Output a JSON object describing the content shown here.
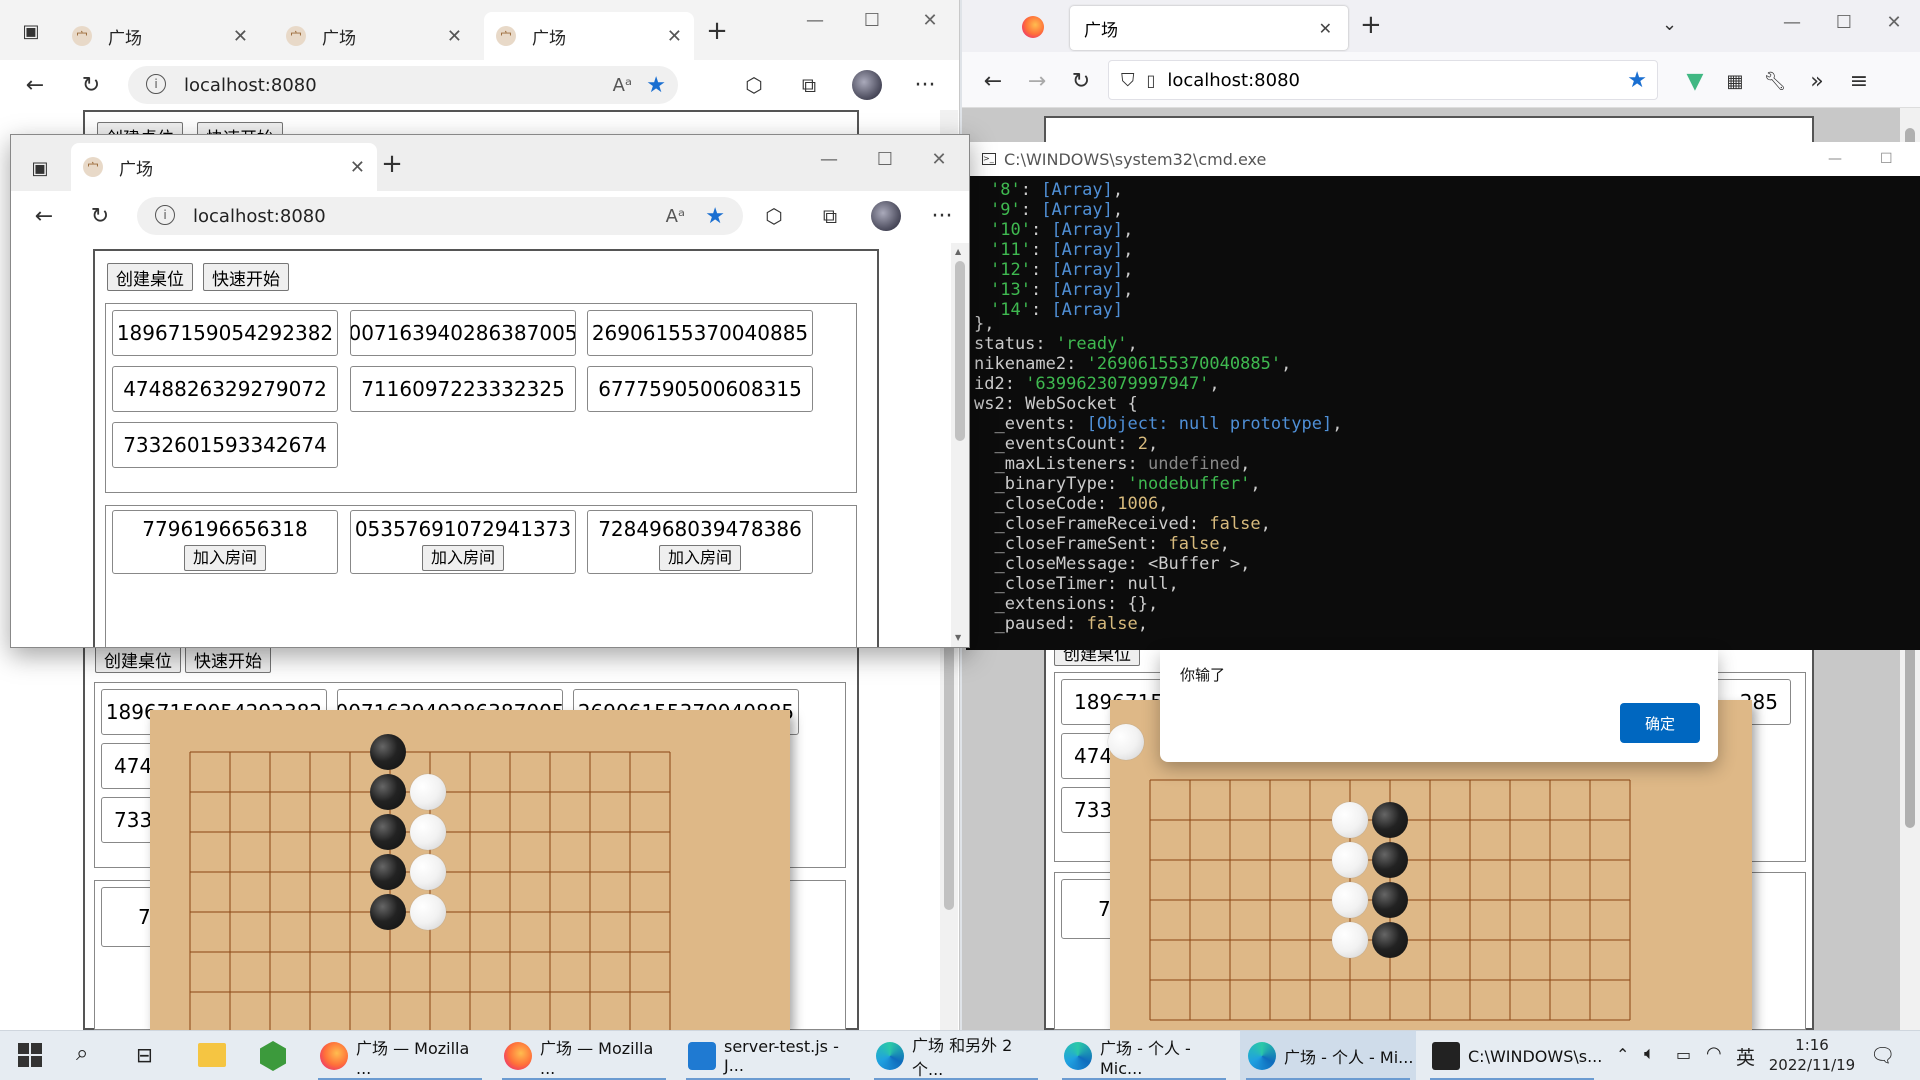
{
  "edge_back": {
    "tabs": [
      {
        "title": "广场"
      },
      {
        "title": "广场"
      },
      {
        "title": "广场"
      }
    ],
    "url": "localhost:8080",
    "page_buttons": [
      "创建桌位",
      "快速开始"
    ]
  },
  "edge_front": {
    "tab_title": "广场",
    "url": "localhost:8080",
    "create_button": "创建桌位",
    "quick_button": "快速开始",
    "players": [
      "18967159054292382",
      "007163940286387005",
      "26906155370040885",
      "4748826329279072",
      "7116097223332325",
      "6777590500608315",
      "7332601593342674"
    ],
    "rooms": [
      {
        "number": "7796196656318",
        "join": "加入房间"
      },
      {
        "number": "05357691072941373",
        "join": "加入房间"
      },
      {
        "number": "7284968039478386",
        "join": "加入房间"
      }
    ]
  },
  "behind_left": {
    "buttons": [
      "创建桌位",
      "快速开始"
    ],
    "players": [
      "18967159054292382",
      "007163940286387005",
      "26906155370040885",
      "474",
      "733"
    ],
    "rooms": [
      "7"
    ]
  },
  "behind_right": {
    "buttons": [
      "创建桌位"
    ],
    "players": [
      "18967150",
      "285",
      "474",
      "733"
    ],
    "rooms": [
      "7"
    ]
  },
  "firefox": {
    "tab_title": "广场",
    "url": "localhost:8080"
  },
  "cmd": {
    "title": "C:\\WINDOWS\\system32\\cmd.exe"
  },
  "dialog": {
    "message": "你输了",
    "ok": "确定"
  },
  "taskbar": {
    "apps": [
      {
        "label": "广场 — Mozilla ..."
      },
      {
        "label": "广场 — Mozilla ..."
      },
      {
        "label": "server-test.js - J..."
      },
      {
        "label": "广场 和另外 2 个..."
      },
      {
        "label": "广场 - 个人 - Mic..."
      },
      {
        "label": "广场 - 个人 - Mi..."
      },
      {
        "label": "C:\\WINDOWS\\s..."
      }
    ],
    "ime": "英",
    "time": "1:16",
    "date": "2022/11/19"
  },
  "colors": {
    "board": "#deb887",
    "accent": "#0067c0",
    "cmd_bg": "#0c0c0c"
  }
}
